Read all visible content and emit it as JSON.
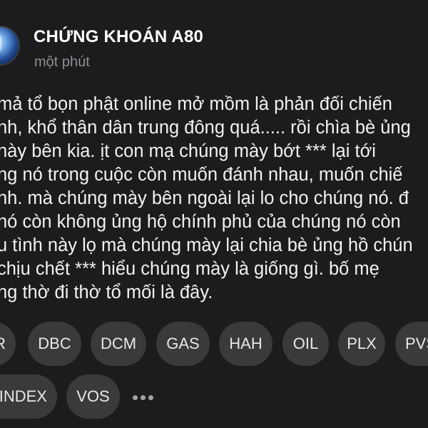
{
  "account": {
    "name": "CHỨNG KHOÁN A80",
    "time": "một phút"
  },
  "post": {
    "lines": [
      "mả tổ bọn phật online mở mồm là phản đối  chiến",
      "nh, khổ thân dân trung đông quá..... rồi chìa bè ủng",
      " này bên kia. ịt con mạ chúng mày bớt *** lại tới",
      "ng nó trong cuộc còn muốn đánh nhau, muốn chiế",
      "nh. mà chúng mày bên ngoài lại lo cho chúng nó. đ",
      " nó còn không ủng hộ chính phủ của chúng nó còn",
      "u tình này lọ mà chúng mày lại chia bè ủng hồ chún",
      " chịu chết *** hiểu chúng mày là giống gì. bố mẹ",
      "ng thờ đi thờ tổ mối là đây."
    ]
  },
  "tags": {
    "row1": [
      "R",
      "DBC",
      "DCM",
      "GAS",
      "HAH",
      "OIL",
      "PLX",
      "PVS"
    ],
    "row2": [
      "INDEX",
      "VOS"
    ]
  },
  "colors": {
    "background": "#1c1c1e",
    "tag_background": "#3a3a3c",
    "secondary_text": "#8e8e93"
  },
  "icons": {
    "more": "ellipsis-icon"
  }
}
